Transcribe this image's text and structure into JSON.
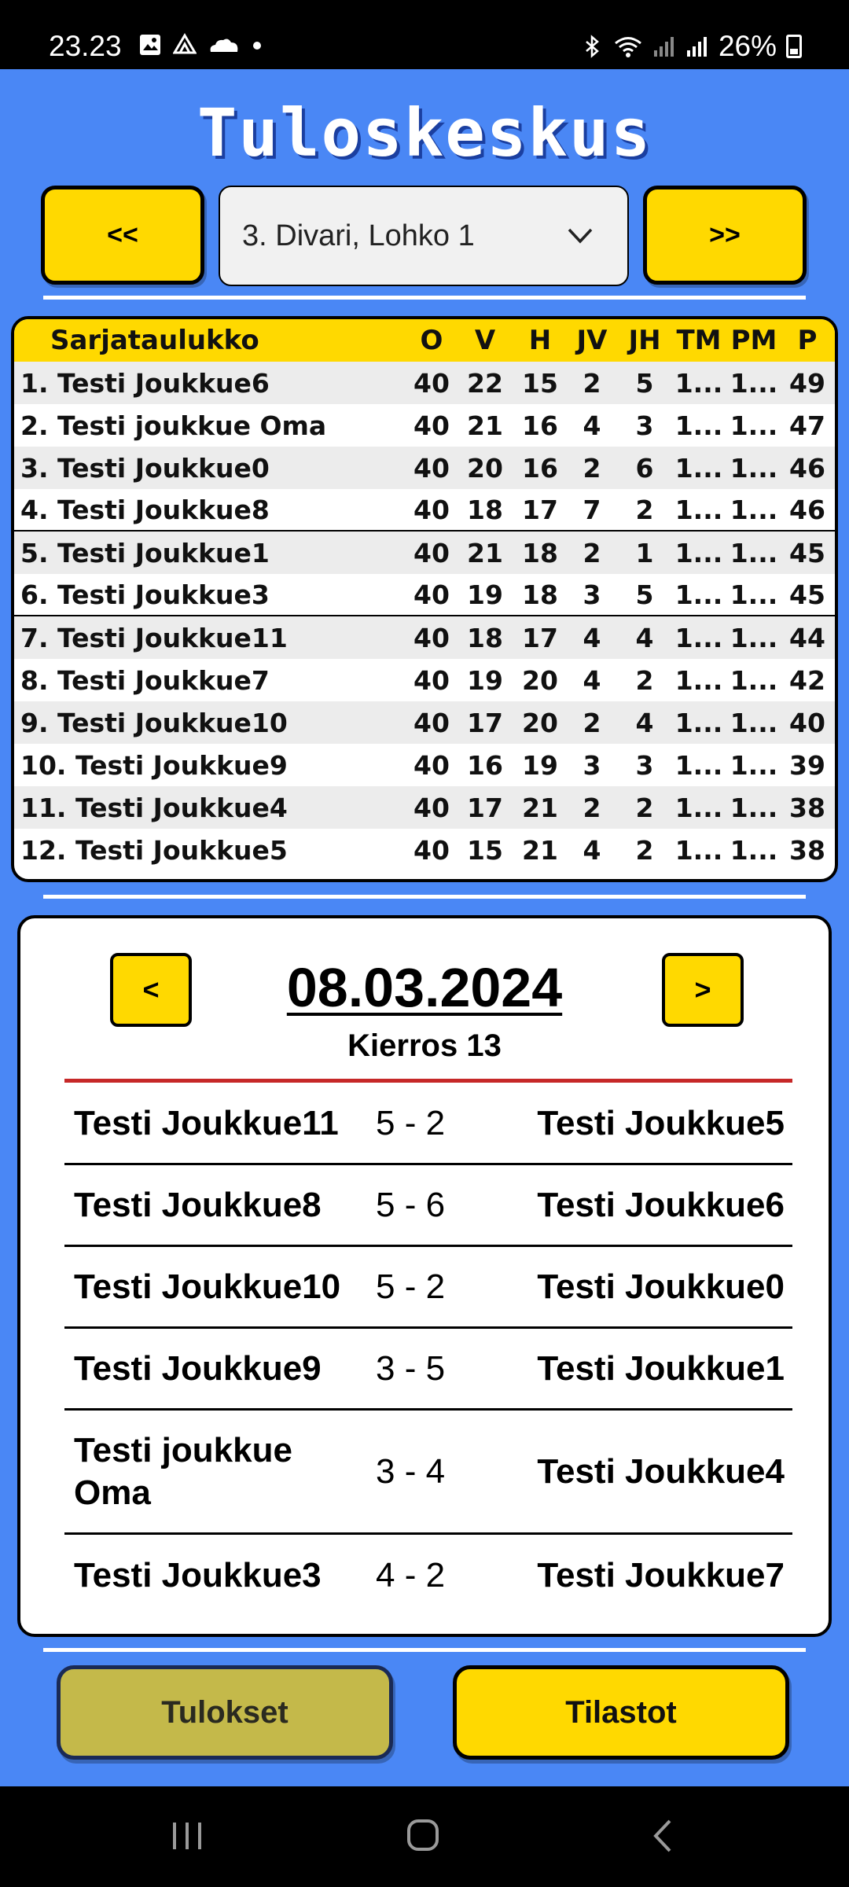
{
  "status_bar": {
    "time": "23.23",
    "battery_percent": "26%"
  },
  "app": {
    "title": "Tuloskeskus"
  },
  "division_selector": {
    "prev_label": "<<",
    "next_label": ">>",
    "selected": "3. Divari, Lohko 1"
  },
  "standings": {
    "headers": {
      "team": "Sarjataulukko",
      "o": "O",
      "v": "V",
      "h": "H",
      "jv": "JV",
      "jh": "JH",
      "tm": "TM",
      "pm": "PM",
      "p": "P"
    },
    "rows": [
      {
        "team": "1. Testi Joukkue6",
        "o": "40",
        "v": "22",
        "h": "15",
        "jv": "2",
        "jh": "5",
        "tm": "1...",
        "pm": "1...",
        "p": "49"
      },
      {
        "team": "2. Testi joukkue Oma",
        "o": "40",
        "v": "21",
        "h": "16",
        "jv": "4",
        "jh": "3",
        "tm": "1...",
        "pm": "1...",
        "p": "47"
      },
      {
        "team": "3. Testi Joukkue0",
        "o": "40",
        "v": "20",
        "h": "16",
        "jv": "2",
        "jh": "6",
        "tm": "1...",
        "pm": "1...",
        "p": "46"
      },
      {
        "team": "4. Testi Joukkue8",
        "o": "40",
        "v": "18",
        "h": "17",
        "jv": "7",
        "jh": "2",
        "tm": "1...",
        "pm": "1...",
        "p": "46"
      },
      {
        "team": "5. Testi Joukkue1",
        "o": "40",
        "v": "21",
        "h": "18",
        "jv": "2",
        "jh": "1",
        "tm": "1...",
        "pm": "1...",
        "p": "45"
      },
      {
        "team": "6. Testi Joukkue3",
        "o": "40",
        "v": "19",
        "h": "18",
        "jv": "3",
        "jh": "5",
        "tm": "1...",
        "pm": "1...",
        "p": "45"
      },
      {
        "team": "7. Testi Joukkue11",
        "o": "40",
        "v": "18",
        "h": "17",
        "jv": "4",
        "jh": "4",
        "tm": "1...",
        "pm": "1...",
        "p": "44"
      },
      {
        "team": "8. Testi Joukkue7",
        "o": "40",
        "v": "19",
        "h": "20",
        "jv": "4",
        "jh": "2",
        "tm": "1...",
        "pm": "1...",
        "p": "42"
      },
      {
        "team": "9. Testi Joukkue10",
        "o": "40",
        "v": "17",
        "h": "20",
        "jv": "2",
        "jh": "4",
        "tm": "1...",
        "pm": "1...",
        "p": "40"
      },
      {
        "team": "10. Testi Joukkue9",
        "o": "40",
        "v": "16",
        "h": "19",
        "jv": "3",
        "jh": "3",
        "tm": "1...",
        "pm": "1...",
        "p": "39"
      },
      {
        "team": "11. Testi Joukkue4",
        "o": "40",
        "v": "17",
        "h": "21",
        "jv": "2",
        "jh": "2",
        "tm": "1...",
        "pm": "1...",
        "p": "38"
      },
      {
        "team": "12. Testi Joukkue5",
        "o": "40",
        "v": "15",
        "h": "21",
        "jv": "4",
        "jh": "2",
        "tm": "1...",
        "pm": "1...",
        "p": "38"
      }
    ]
  },
  "round": {
    "prev_label": "<",
    "next_label": ">",
    "date": "08.03.2024",
    "label": "Kierros 13",
    "matches": [
      {
        "home": "Testi Joukkue11",
        "score": "5 - 2",
        "away": "Testi Joukkue5"
      },
      {
        "home": "Testi Joukkue8",
        "score": "5 - 6",
        "away": "Testi Joukkue6"
      },
      {
        "home": "Testi Joukkue10",
        "score": "5 - 2",
        "away": "Testi Joukkue0"
      },
      {
        "home": "Testi Joukkue9",
        "score": "3 - 5",
        "away": "Testi Joukkue1"
      },
      {
        "home": "Testi joukkue Oma",
        "score": "3 - 4",
        "away": "Testi Joukkue4"
      },
      {
        "home": "Testi Joukkue3",
        "score": "4 - 2",
        "away": "Testi Joukkue7"
      }
    ]
  },
  "bottom_nav": {
    "results_label": "Tulokset",
    "stats_label": "Tilastot"
  },
  "colors": {
    "background": "#4a87f5",
    "accent": "#ffd900",
    "divider_red": "#c62828"
  }
}
